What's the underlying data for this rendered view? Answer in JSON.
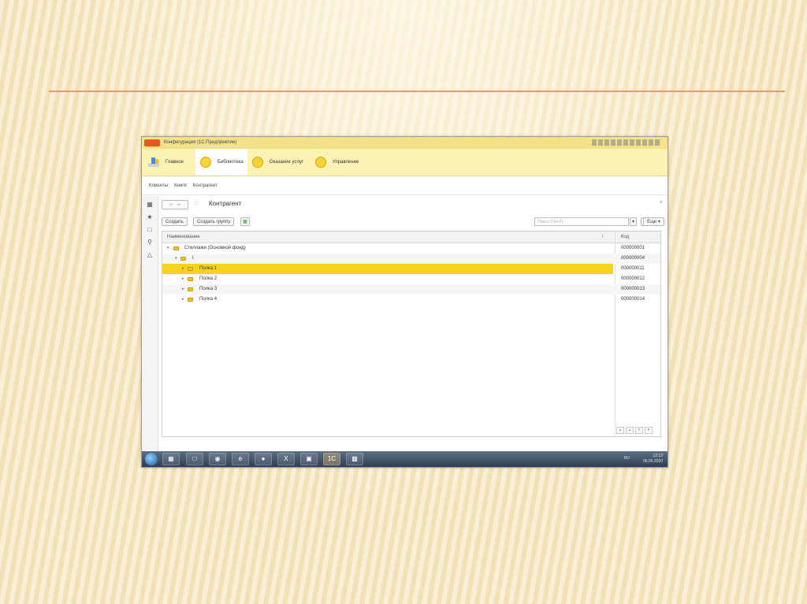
{
  "window": {
    "title": "Конфигурация (1С:Предприятие)"
  },
  "sections": [
    {
      "label": "Главное",
      "icon": "home-icon"
    },
    {
      "label": "Библиотека",
      "icon": "circle-icon",
      "active": true
    },
    {
      "label": "Оказание услуг",
      "icon": "circle-icon"
    },
    {
      "label": "Управление",
      "icon": "circle-icon"
    }
  ],
  "subnav": [
    "Клиенты",
    "Книги",
    "Контрагент"
  ],
  "form": {
    "title": "Контрагент",
    "create_label": "Создать",
    "create_group_label": "Создать группу",
    "search_placeholder": "Поиск (Ctrl+F)",
    "more_label": "Еще"
  },
  "table": {
    "columns": {
      "name": "Наименование",
      "code": "Код"
    },
    "rows": [
      {
        "name": "Стеллажи (Основной фонд)",
        "code": "000000001",
        "level": 1,
        "selected": false
      },
      {
        "name": "I",
        "code": "000000004",
        "level": 2,
        "selected": false
      },
      {
        "name": "Полка 1",
        "code": "000000011",
        "level": 3,
        "selected": true
      },
      {
        "name": "Полка 2",
        "code": "000000012",
        "level": 3,
        "selected": false
      },
      {
        "name": "Полка 3",
        "code": "000000013",
        "level": 3,
        "selected": false
      },
      {
        "name": "Полка 4",
        "code": "000000014",
        "level": 3,
        "selected": false
      }
    ]
  },
  "taskbar": {
    "lang": "RU",
    "time": "12:13",
    "date": "06.05.2020"
  },
  "colors": {
    "accent_yellow": "#f7d21f",
    "slide_line": "#e8a23a",
    "section_bar": "#fbf3b4"
  }
}
